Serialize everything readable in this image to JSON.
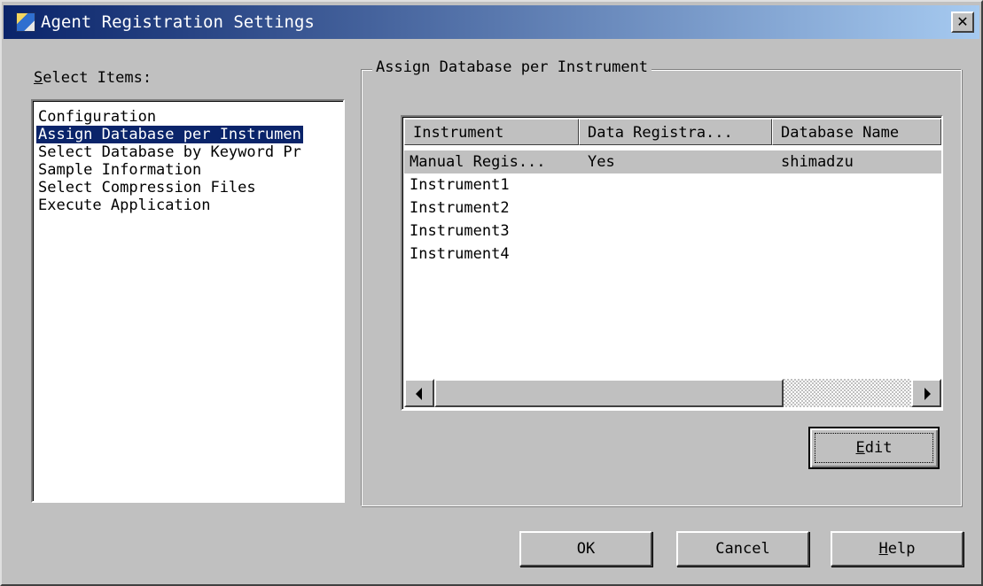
{
  "window": {
    "title": "Agent Registration Settings",
    "close_glyph": "✕"
  },
  "select_items": {
    "label_accel": "S",
    "label_rest": "elect Items:",
    "items": [
      {
        "label": "Configuration",
        "selected": false
      },
      {
        "label": "Assign Database per Instrumen",
        "selected": true
      },
      {
        "label": "Select Database by Keyword Pr",
        "selected": false
      },
      {
        "label": "Sample Information",
        "selected": false
      },
      {
        "label": "Select Compression Files",
        "selected": false
      },
      {
        "label": "Execute Application",
        "selected": false
      }
    ]
  },
  "group": {
    "title": "Assign Database per Instrument",
    "columns": [
      "Instrument",
      "Data Registra...",
      "Database Name"
    ],
    "rows": [
      {
        "instrument": "Manual Regis...",
        "data_registration": "Yes",
        "database_name": "shimadzu",
        "selected": true
      },
      {
        "instrument": "Instrument1",
        "data_registration": "",
        "database_name": "",
        "selected": false
      },
      {
        "instrument": "Instrument2",
        "data_registration": "",
        "database_name": "",
        "selected": false
      },
      {
        "instrument": "Instrument3",
        "data_registration": "",
        "database_name": "",
        "selected": false
      },
      {
        "instrument": "Instrument4",
        "data_registration": "",
        "database_name": "",
        "selected": false
      }
    ],
    "edit_button": {
      "accel": "E",
      "rest": "dit"
    }
  },
  "buttons": {
    "ok": "OK",
    "cancel": "Cancel",
    "help": {
      "accel": "H",
      "rest": "elp"
    }
  },
  "colors": {
    "selection": "#0a246a",
    "face": "#c0c0c0",
    "title_gradient_end": "#a6caf0"
  }
}
